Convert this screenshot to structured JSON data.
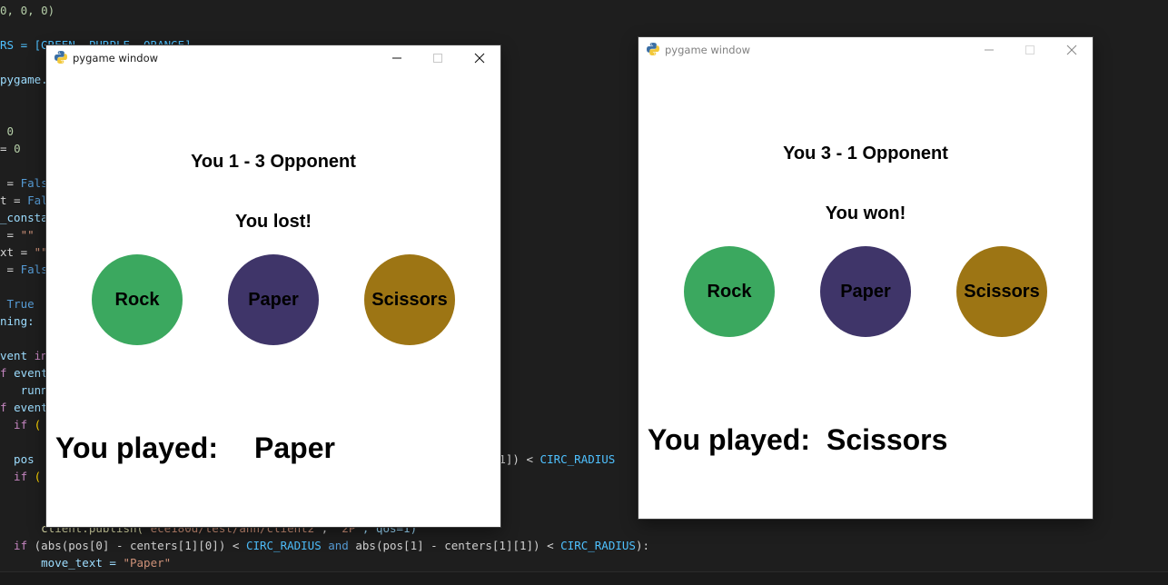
{
  "editor": {
    "lines": [
      [
        {
          "t": "0, 0, 0)",
          "c": "#b5cea8"
        }
      ],
      [],
      [
        {
          "t": "RS = [",
          "c": "#4fc1ff"
        },
        {
          "t": "GREEN, PURPLE, ORANGE]",
          "c": "#4fc1ff"
        }
      ],
      [],
      [
        {
          "t": "pygame.",
          "c": "#9cdcfe"
        }
      ],
      [],
      [],
      [
        {
          "t": " 0",
          "c": "#b5cea8"
        }
      ],
      [
        {
          "t": "= ",
          "c": "#d4d4d4"
        },
        {
          "t": "0",
          "c": "#b5cea8"
        }
      ],
      [],
      [
        {
          "t": " = ",
          "c": "#d4d4d4"
        },
        {
          "t": "False",
          "c": "#569cd6"
        }
      ],
      [
        {
          "t": "t = ",
          "c": "#d4d4d4"
        },
        {
          "t": "Fals",
          "c": "#569cd6"
        }
      ],
      [
        {
          "t": "_consta",
          "c": "#9cdcfe"
        }
      ],
      [
        {
          "t": " = ",
          "c": "#d4d4d4"
        },
        {
          "t": "\"\"",
          "c": "#ce9178"
        }
      ],
      [
        {
          "t": "xt = ",
          "c": "#d4d4d4"
        },
        {
          "t": "\"\"",
          "c": "#ce9178"
        }
      ],
      [
        {
          "t": " = ",
          "c": "#d4d4d4"
        },
        {
          "t": "False",
          "c": "#569cd6"
        }
      ],
      [],
      [
        {
          "t": " True",
          "c": "#569cd6"
        }
      ],
      [
        {
          "t": "ning:",
          "c": "#9cdcfe"
        }
      ],
      [],
      [
        {
          "t": "vent ",
          "c": "#9cdcfe"
        },
        {
          "t": "in",
          "c": "#c586c0"
        }
      ],
      [
        {
          "t": "f ",
          "c": "#c586c0"
        },
        {
          "t": "event",
          "c": "#9cdcfe"
        }
      ],
      [
        {
          "t": "   runn",
          "c": "#9cdcfe"
        }
      ],
      [
        {
          "t": "f ",
          "c": "#c586c0"
        },
        {
          "t": "event",
          "c": "#9cdcfe"
        }
      ],
      [
        {
          "t": "  if ",
          "c": "#c586c0"
        },
        {
          "t": "(",
          "c": "#ffd700"
        }
      ],
      [],
      [
        {
          "t": "  pos",
          "c": "#9cdcfe"
        },
        {
          "t": "                                                               s[0][1]) < ",
          "c": "#d4d4d4"
        },
        {
          "t": "CIRC_RADIUS",
          "c": "#4fc1ff"
        }
      ],
      [
        {
          "t": "  if ",
          "c": "#c586c0"
        },
        {
          "t": "(",
          "c": "#ffd700"
        }
      ],
      [],
      [],
      [
        {
          "t": "      client.publish(",
          "c": "#dcdcaa"
        },
        {
          "t": "\"ece180d/test/ann/client2\"",
          "c": "#ce9178"
        },
        {
          "t": ", ",
          "c": "#d4d4d4"
        },
        {
          "t": "\"2P\"",
          "c": "#ce9178"
        },
        {
          "t": ", qos=1)",
          "c": "#9cdcfe"
        }
      ],
      [
        {
          "t": "  if ",
          "c": "#c586c0"
        },
        {
          "t": "(abs(pos[0] - centers[1][0]) < ",
          "c": "#d4d4d4"
        },
        {
          "t": "CIRC_RADIUS",
          "c": "#4fc1ff"
        },
        {
          "t": " and ",
          "c": "#569cd6"
        },
        {
          "t": "abs(pos[1] - centers[1][1]) < ",
          "c": "#d4d4d4"
        },
        {
          "t": "CIRC_RADIUS",
          "c": "#4fc1ff"
        },
        {
          "t": "):",
          "c": "#d4d4d4"
        }
      ],
      [
        {
          "t": "      move_text = ",
          "c": "#9cdcfe"
        },
        {
          "t": "\"Paper\"",
          "c": "#ce9178"
        }
      ]
    ]
  },
  "colors": {
    "rock": "#3ba85f",
    "paper": "#3f3569",
    "scissors": "#9d7514"
  },
  "windows": [
    {
      "title": "pygame window",
      "score": "You 1 - 3 Opponent",
      "result": "You lost!",
      "buttons": {
        "rock": "Rock",
        "paper": "Paper",
        "scissors": "Scissors"
      },
      "played_label": "You played:",
      "played_move": "Paper",
      "icons": [
        "python-icon",
        "minimize-icon",
        "maximize-icon",
        "close-icon"
      ]
    },
    {
      "title": "pygame window",
      "score": "You 3 - 1 Opponent",
      "result": "You won!",
      "buttons": {
        "rock": "Rock",
        "paper": "Paper",
        "scissors": "Scissors"
      },
      "played_label": "You played:",
      "played_move": "Scissors",
      "icons": [
        "python-icon",
        "minimize-icon",
        "maximize-icon",
        "close-icon"
      ]
    }
  ]
}
